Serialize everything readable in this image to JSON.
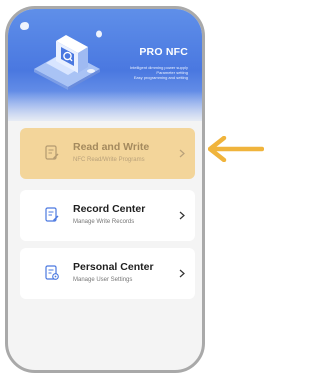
{
  "header": {
    "title": "PRO NFC",
    "features": [
      "Intelligent dimming power supply",
      "Parameter setting",
      "Easy programming and setting"
    ]
  },
  "menu": [
    {
      "title": "Read and Write",
      "subtitle": "NFC Read/Write Programs",
      "icon": "nfc-read-write-icon",
      "active": true
    },
    {
      "title": "Record Center",
      "subtitle": "Manage Write Records",
      "icon": "record-icon",
      "active": false
    },
    {
      "title": "Personal Center",
      "subtitle": "Manage User Settings",
      "icon": "personal-settings-icon",
      "active": false
    }
  ],
  "colors": {
    "hero_blue": "#4a78e0",
    "highlight": "#f3d59a",
    "pointer_arrow": "#f0b43c"
  }
}
